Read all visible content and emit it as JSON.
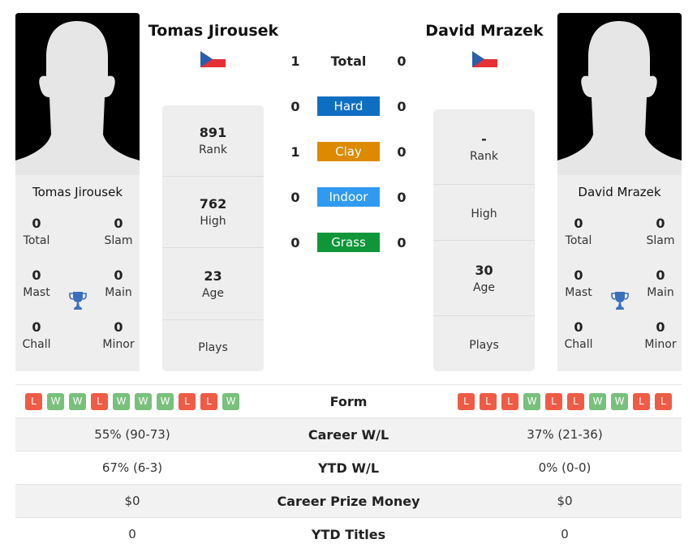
{
  "players": [
    {
      "name": "Tomas Jirousek",
      "country": "Czech Republic",
      "flag_icon": "czech-flag-icon",
      "titles": {
        "total": {
          "value": "0",
          "label": "Total"
        },
        "slam": {
          "value": "0",
          "label": "Slam"
        },
        "mast": {
          "value": "0",
          "label": "Mast"
        },
        "main": {
          "value": "0",
          "label": "Main"
        },
        "chall": {
          "value": "0",
          "label": "Chall"
        },
        "minor": {
          "value": "0",
          "label": "Minor"
        }
      },
      "stats": [
        {
          "value": "891",
          "label": "Rank"
        },
        {
          "value": "762",
          "label": "High"
        },
        {
          "value": "23",
          "label": "Age"
        },
        {
          "value": "",
          "label": "Plays"
        }
      ],
      "form": [
        "L",
        "W",
        "W",
        "L",
        "W",
        "W",
        "W",
        "L",
        "L",
        "W"
      ],
      "career_wl": "55% (90-73)",
      "ytd_wl": "67% (6-3)",
      "career_prize": "$0",
      "ytd_titles": "0"
    },
    {
      "name": "David Mrazek",
      "country": "Czech Republic",
      "flag_icon": "czech-flag-icon",
      "titles": {
        "total": {
          "value": "0",
          "label": "Total"
        },
        "slam": {
          "value": "0",
          "label": "Slam"
        },
        "mast": {
          "value": "0",
          "label": "Mast"
        },
        "main": {
          "value": "0",
          "label": "Main"
        },
        "chall": {
          "value": "0",
          "label": "Chall"
        },
        "minor": {
          "value": "0",
          "label": "Minor"
        }
      },
      "stats": [
        {
          "value": "-",
          "label": "Rank"
        },
        {
          "value": "",
          "label": "High"
        },
        {
          "value": "30",
          "label": "Age"
        },
        {
          "value": "",
          "label": "Plays"
        }
      ],
      "form": [
        "L",
        "L",
        "L",
        "W",
        "L",
        "L",
        "W",
        "W",
        "L",
        "L"
      ],
      "career_wl": "37% (21-36)",
      "ytd_wl": "0% (0-0)",
      "career_prize": "$0",
      "ytd_titles": "0"
    }
  ],
  "h2h": {
    "total": {
      "label": "Total",
      "p1": "1",
      "p2": "0"
    },
    "surfaces": [
      {
        "label": "Hard",
        "p1": "0",
        "p2": "0",
        "color": "#0e6fc2"
      },
      {
        "label": "Clay",
        "p1": "1",
        "p2": "0",
        "color": "#dd8a00"
      },
      {
        "label": "Indoor",
        "p1": "0",
        "p2": "0",
        "color": "#2f9af0"
      },
      {
        "label": "Grass",
        "p1": "0",
        "p2": "0",
        "color": "#0e9638"
      }
    ]
  },
  "table": {
    "form_label": "Form",
    "career_wl_label": "Career W/L",
    "ytd_wl_label": "YTD W/L",
    "career_prize_label": "Career Prize Money",
    "ytd_titles_label": "YTD Titles"
  },
  "colors": {
    "loss": "#ef5b45",
    "win": "#78c07b",
    "trophy": "#3a6fbf"
  }
}
